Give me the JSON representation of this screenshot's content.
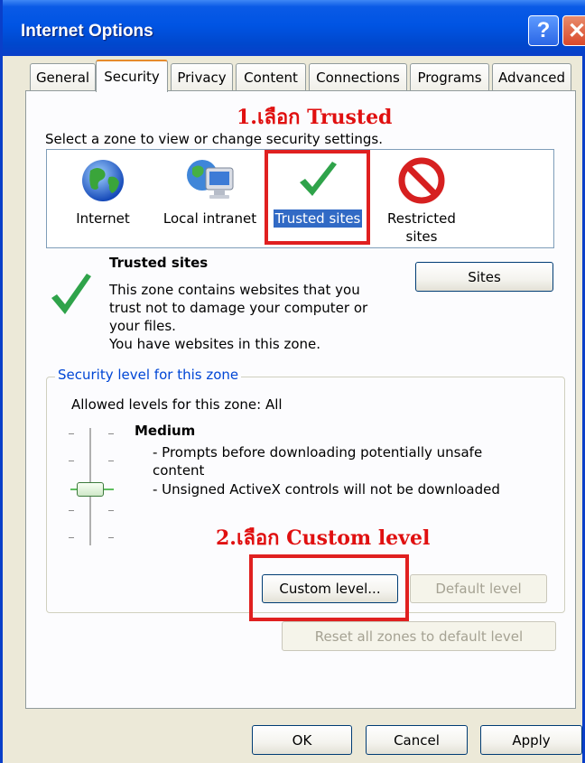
{
  "window": {
    "title": "Internet Options"
  },
  "titlebar": {
    "help_glyph": "?",
    "close_glyph": "✕"
  },
  "tabs": [
    {
      "label": "General"
    },
    {
      "label": "Security"
    },
    {
      "label": "Privacy"
    },
    {
      "label": "Content"
    },
    {
      "label": "Connections"
    },
    {
      "label": "Programs"
    },
    {
      "label": "Advanced"
    }
  ],
  "active_tab": "Security",
  "annotations": {
    "step1": "1.เลือก Trusted",
    "step2": "2.เลือก Custom level",
    "color": "#e01010"
  },
  "security": {
    "zone_prompt": "Select a zone to view or change security settings.",
    "zones": [
      {
        "label": "Internet",
        "icon": "globe-icon"
      },
      {
        "label": "Local intranet",
        "icon": "computer-network-icon"
      },
      {
        "label": "Trusted sites",
        "icon": "checkmark-icon",
        "selected": true
      },
      {
        "label_line1": "Restricted",
        "label_line2": "sites",
        "icon": "no-entry-icon"
      }
    ],
    "zone_title": "Trusted sites",
    "zone_desc_1": "This zone contains websites that you",
    "zone_desc_2": "trust not to damage your computer or",
    "zone_desc_3": "your files.",
    "zone_desc_4": "You have websites in this zone.",
    "sites_button": "Sites",
    "level_group_title": "Security level for this zone",
    "allowed_levels": "Allowed levels for this zone: All",
    "level_name": "Medium",
    "level_bullet_1a": "- Prompts before downloading potentially unsafe",
    "level_bullet_1b": "content",
    "level_bullet_2": "- Unsigned ActiveX controls will not be downloaded",
    "custom_level_button": "Custom level...",
    "default_level_button": "Default level",
    "reset_all_button": "Reset all zones to default level"
  },
  "footer": {
    "ok": "OK",
    "cancel": "Cancel",
    "apply": "Apply"
  },
  "colors": {
    "title_bar": "#0054e3",
    "selection": "#316ac5",
    "group_title": "#0046d5",
    "check_green": "#2fa34a"
  }
}
